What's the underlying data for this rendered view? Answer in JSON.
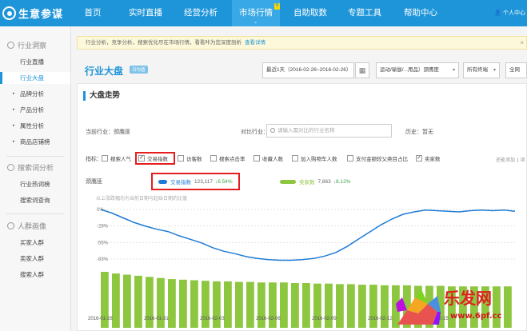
{
  "app": {
    "logo": "生意参谋",
    "user": "个人中心"
  },
  "nav": [
    {
      "label": "首页"
    },
    {
      "label": "实时直播"
    },
    {
      "label": "经营分析"
    },
    {
      "label": "市场行情",
      "badge": "专",
      "active": true
    },
    {
      "label": "自助取数"
    },
    {
      "label": "专题工具"
    },
    {
      "label": "帮助中心"
    }
  ],
  "sidebar": {
    "sec1": "行业洞察",
    "item_dapan": "行业直播",
    "item_active": "行业大盘",
    "item_brand": "品牌分析",
    "item_product": "产品分析",
    "item_attr": "属性分析",
    "item_shop": "商品店铺榜",
    "sec2": "搜索词分析",
    "item_hotword": "行业热词榜",
    "item_query": "搜索词查询",
    "sec3": "人群画像",
    "item_buyer": "买家人群",
    "item_seller": "卖家人群",
    "item_visitor": "搜索人群"
  },
  "notice": {
    "text": "行业分析，竞争分析，搜索优化尽在市场行情，看看咔为您深度剖析",
    "link": "查看详情",
    "close": "×"
  },
  "page": {
    "title": "行业大盘",
    "tag": "日均值"
  },
  "filters": {
    "date": "最近1天（2016-02-26~2016-02-26）",
    "category": "运动/瑜伽/...用品）颈鹰匪",
    "terminal": "所有终端",
    "region": "全网"
  },
  "section": {
    "title": "大盘走势"
  },
  "compare": {
    "current_label": "当前行业：颈鹰匪",
    "compare_label": "对比行业：",
    "placeholder": "请输入需对比的行业名称",
    "history": "历史：暂无"
  },
  "metrics": {
    "label": "指标：",
    "items": [
      "搜索人气",
      "交易指数",
      "访客数",
      "搜索点击率",
      "收藏人数",
      "加入购物车人数",
      "支付金额较父类目占比",
      "卖家数"
    ],
    "checked": [
      1,
      7
    ],
    "extra": "还能添加 1 项"
  },
  "legend": {
    "name": "颈鹰匪",
    "s1_label": "交易指数",
    "s1_value": "123,117",
    "s1_change": "↓6.54%",
    "s2_label": "卖家数",
    "s2_value": "7,863",
    "s2_change": "↓8.12%",
    "note": "以上涨跌幅均为当前日期与起始日期的比值"
  },
  "chart_data": {
    "type": "line+bar",
    "y_ticks": [
      "0%",
      "-28%",
      "-55%",
      "-83%"
    ],
    "x_ticks": [
      "2016-01-28",
      "2016-01-31",
      "2016-02-03",
      "2016-02-06",
      "2016-02-09",
      "2016-02-12",
      "2016-02-15"
    ],
    "line_values": [
      0,
      -6,
      -14,
      -22,
      -28,
      -33,
      -37,
      -44,
      -50,
      -56,
      -64,
      -70,
      -74,
      -79,
      -82,
      -84,
      -85,
      -85,
      -84,
      -82,
      -78,
      -72,
      -62,
      -50,
      -38,
      -26,
      -16,
      -8,
      -4,
      -1,
      -2,
      -3,
      -4,
      -2,
      -1,
      -2,
      -1,
      -3
    ],
    "bar_values": [
      100,
      97,
      95,
      93,
      91,
      89,
      87,
      86,
      85,
      84,
      83,
      83,
      82,
      82,
      81,
      81,
      81,
      80,
      80,
      79,
      79,
      78,
      78,
      77,
      77,
      76,
      76,
      76,
      75,
      75,
      75,
      74,
      74,
      74,
      74,
      74,
      74
    ],
    "colors": {
      "line": "#1e7bd6",
      "bar": "#8dc63f"
    }
  },
  "watermark": {
    "text": "乐发网",
    "url": "www.6pf.cc"
  }
}
